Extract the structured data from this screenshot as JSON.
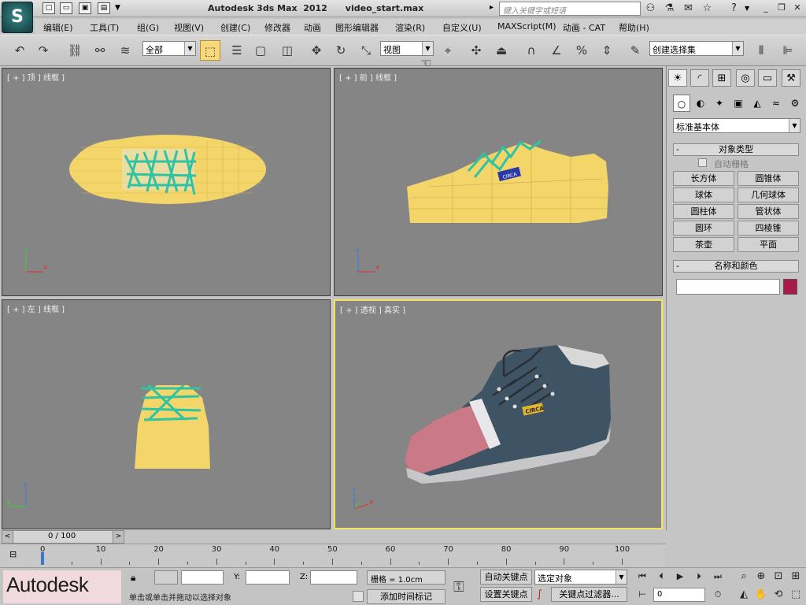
{
  "window": {
    "title": "Autodesk 3ds Max  2012      video_start.max",
    "search_placeholder": "键入关键字或短语"
  },
  "menu": [
    "编辑(E)",
    "工具(T)",
    "组(G)",
    "视图(V)",
    "创建(C)",
    "修改器",
    "动画",
    "图形编辑器",
    "渲染(R)",
    "自定义(U)",
    "MAXScript(M)",
    "动画 - CAT",
    "帮助(H)"
  ],
  "toolbar": {
    "selection_filter": "全部",
    "ref_coord": "视图",
    "named_selection": "创建选择集"
  },
  "viewports": {
    "top": "[ + ] 顶 ] 线框 ]",
    "front": "[ + ] 前 ] 线框 ]",
    "left": "[ + ] 左 ] 线框 ]",
    "persp": "[ + ] 透视 ] 真实 ]",
    "logo_text": "CIRCA"
  },
  "command_panel": {
    "category": "标准基本体",
    "object_type_title": "对象类型",
    "autogrid": "自动栅格",
    "objects": [
      "长方体",
      "圆锥体",
      "球体",
      "几何球体",
      "圆柱体",
      "管状体",
      "圆环",
      "四棱锥",
      "茶壶",
      "平面"
    ],
    "name_color_title": "名称和颜色",
    "object_color": "#a81a48"
  },
  "timeline": {
    "slider": "0 / 100",
    "ticks": [
      0,
      10,
      20,
      30,
      40,
      50,
      60,
      70,
      80,
      90,
      100
    ]
  },
  "status": {
    "logo": "Autodesk",
    "prompt": "单击或单击并拖动以选择对象",
    "grid": "栅格 = 1.0cm",
    "add_time_tag": "添加时间标记",
    "auto_key": "自动关键点",
    "set_key": "设置关键点",
    "selected": "选定对象",
    "key_filters": "关键点过滤器...",
    "frame": "0",
    "z_label": "Z:",
    "y_label": "Y:"
  }
}
